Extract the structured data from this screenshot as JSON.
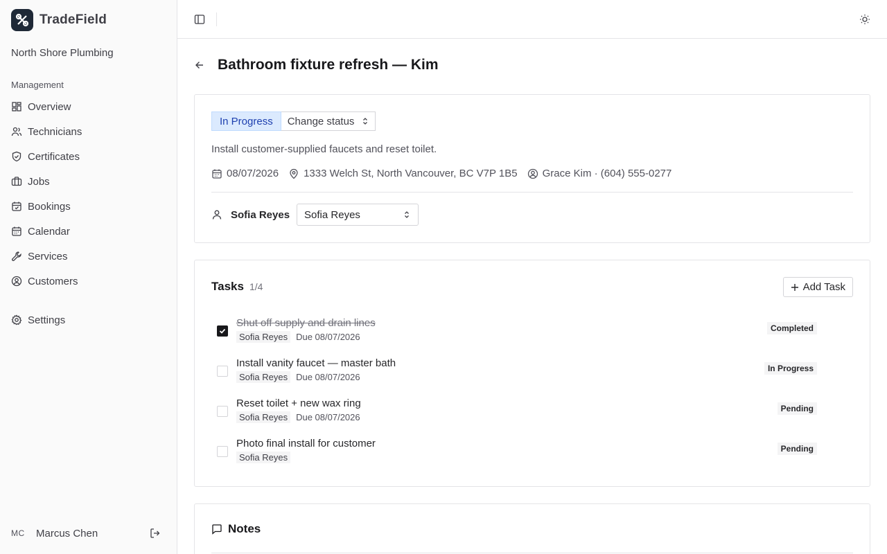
{
  "app": {
    "name": "TradeField",
    "organization": "North Shore Plumbing"
  },
  "sidebar": {
    "section_label": "Management",
    "items": [
      {
        "label": "Overview",
        "icon": "grid-icon"
      },
      {
        "label": "Technicians",
        "icon": "users-icon"
      },
      {
        "label": "Certificates",
        "icon": "shield-check-icon"
      },
      {
        "label": "Jobs",
        "icon": "briefcase-icon"
      },
      {
        "label": "Bookings",
        "icon": "calendar-check-icon"
      },
      {
        "label": "Calendar",
        "icon": "calendar-icon"
      },
      {
        "label": "Services",
        "icon": "wrench-icon"
      },
      {
        "label": "Customers",
        "icon": "user-circle-icon"
      }
    ],
    "settings_label": "Settings",
    "user": {
      "initials": "MC",
      "name": "Marcus Chen"
    }
  },
  "job": {
    "title": "Bathroom fixture refresh —  Kim",
    "status": "In Progress",
    "change_status_label": "Change status",
    "description": "Install customer-supplied faucets and reset toilet.",
    "date": "08/07/2026",
    "address": "1333 Welch St, North Vancouver, BC V7P 1B5",
    "customer": "Grace Kim · (604) 555-0277",
    "assigned_technician": "Sofia Reyes",
    "assign_select_value": "Sofia Reyes"
  },
  "tasks": {
    "title": "Tasks",
    "count": "1/4",
    "add_label": "Add Task",
    "items": [
      {
        "title": "Shut off supply and drain lines",
        "assignee": "Sofia Reyes",
        "due": "Due 08/07/2026",
        "status": "Completed",
        "done": true
      },
      {
        "title": "Install vanity faucet —  master bath",
        "assignee": "Sofia Reyes",
        "due": "Due 08/07/2026",
        "status": "In Progress",
        "done": false
      },
      {
        "title": "Reset toilet + new wax ring",
        "assignee": "Sofia Reyes",
        "due": "Due 08/07/2026",
        "status": "Pending",
        "done": false
      },
      {
        "title": "Photo final install for customer",
        "assignee": "Sofia Reyes",
        "due": "",
        "status": "Pending",
        "done": false
      }
    ]
  },
  "notes": {
    "title": "Notes"
  },
  "colors": {
    "status_badge_bg": "#dbeafe",
    "status_badge_text": "#1e40af",
    "brand_logo_bg": "#1f2937"
  }
}
